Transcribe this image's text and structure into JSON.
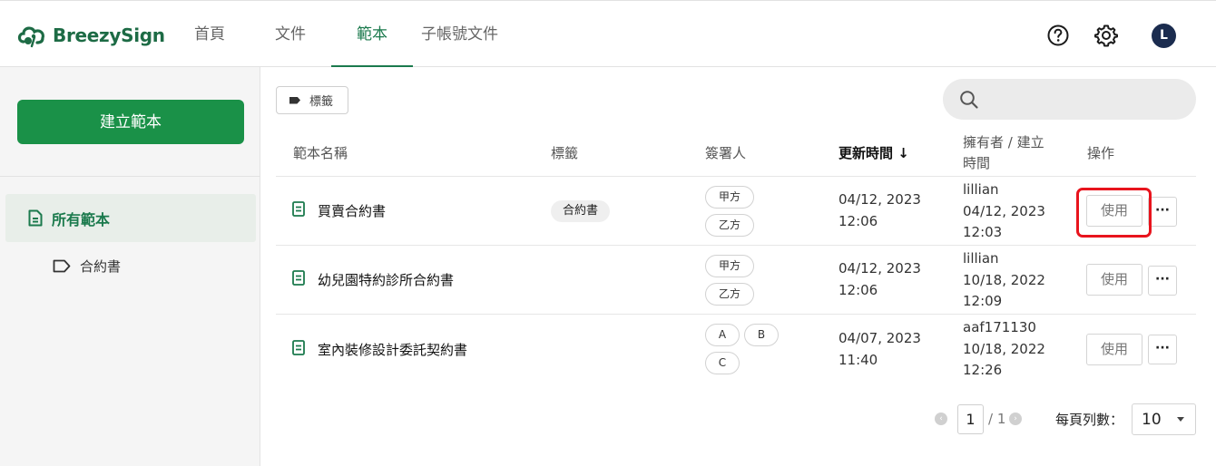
{
  "header": {
    "brand": "BreezySign",
    "nav": [
      {
        "label": "首頁",
        "active": false
      },
      {
        "label": "文件",
        "active": false
      },
      {
        "label": "範本",
        "active": true
      },
      {
        "label": "子帳號文件",
        "active": false
      }
    ],
    "help_icon": "help-circle-icon",
    "settings_icon": "gear-icon",
    "avatar_initial": "L",
    "accent_color": "#1b7a4d"
  },
  "sidebar": {
    "create_label": "建立範本",
    "items": [
      {
        "label": "所有範本",
        "icon": "document-icon",
        "active": true
      },
      {
        "label": "合約書",
        "icon": "tag-outline-icon",
        "active": false
      }
    ]
  },
  "toolbar": {
    "tag_filter_label": "標籤",
    "search_placeholder": ""
  },
  "table": {
    "headers": {
      "name": "範本名稱",
      "tag": "標籤",
      "signers": "簽署人",
      "updated": "更新時間",
      "owner_line1": "擁有者 / 建立",
      "owner_line2": "時間",
      "actions": "操作"
    },
    "sort_arrow": "↓",
    "rows": [
      {
        "name": "買賣合約書",
        "tag": "合約書",
        "signers": [
          "甲方",
          "乙方"
        ],
        "updated_date": "04/12, 2023",
        "updated_time": "12:06",
        "owner": "lillian",
        "created_date": "04/12, 2023",
        "created_time": "12:03",
        "use_label": "使用",
        "more_label": "···",
        "highlighted": true
      },
      {
        "name": "幼兒園特約診所合約書",
        "tag": "",
        "signers": [
          "甲方",
          "乙方"
        ],
        "updated_date": "04/12, 2023",
        "updated_time": "12:06",
        "owner": "lillian",
        "created_date": "10/18, 2022",
        "created_time": "12:09",
        "use_label": "使用",
        "more_label": "···",
        "highlighted": false
      },
      {
        "name": "室內裝修設計委託契約書",
        "tag": "",
        "signers": [
          "A",
          "B",
          "C"
        ],
        "updated_date": "04/07, 2023",
        "updated_time": "11:40",
        "owner": "aaf171130",
        "created_date": "10/18, 2022",
        "created_time": "12:26",
        "use_label": "使用",
        "more_label": "···",
        "highlighted": false
      }
    ]
  },
  "pagination": {
    "current": "1",
    "total": "/ 1",
    "rows_per_page_label": "每頁列數：",
    "rows_per_page": "10"
  }
}
